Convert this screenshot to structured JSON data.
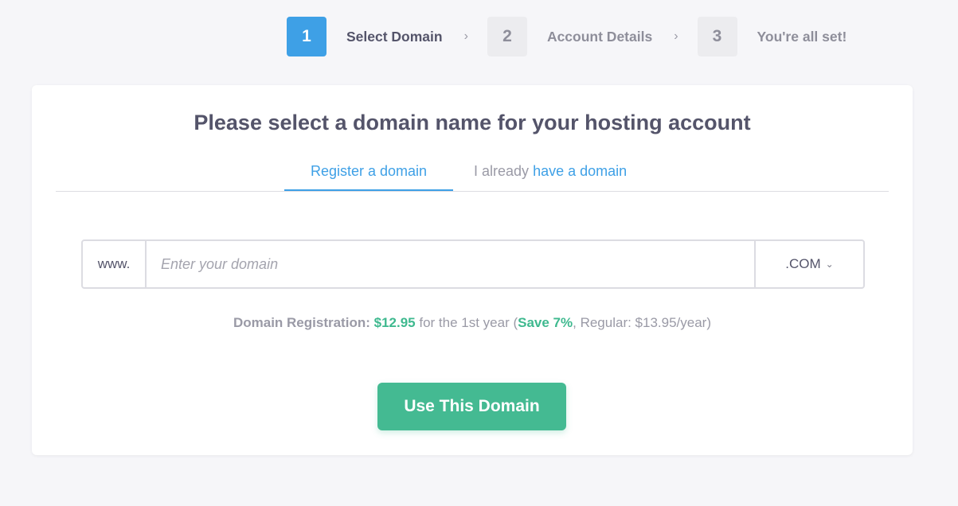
{
  "steps": [
    {
      "number": "1",
      "label": "Select Domain"
    },
    {
      "number": "2",
      "label": "Account Details"
    },
    {
      "number": "3",
      "label": "You're all set!"
    }
  ],
  "chevron": "›",
  "card": {
    "title": "Please select a domain name for your hosting account",
    "tabs": {
      "register": "Register a domain",
      "existing_prefix": "I already",
      "existing_link": "have a domain"
    },
    "domain": {
      "prefix": "www.",
      "placeholder": "Enter your domain",
      "value": "",
      "tld": ".COM"
    },
    "pricing": {
      "label": "Domain Registration:",
      "price": "$12.95",
      "term": "for the 1st year (",
      "save": "Save 7%",
      "regular": ", Regular: $13.95/year)"
    },
    "button": "Use This Domain"
  },
  "colors": {
    "accent": "#3ea0e6",
    "success": "#44ba92",
    "text": "#54546a",
    "muted": "#9a9aa6"
  }
}
